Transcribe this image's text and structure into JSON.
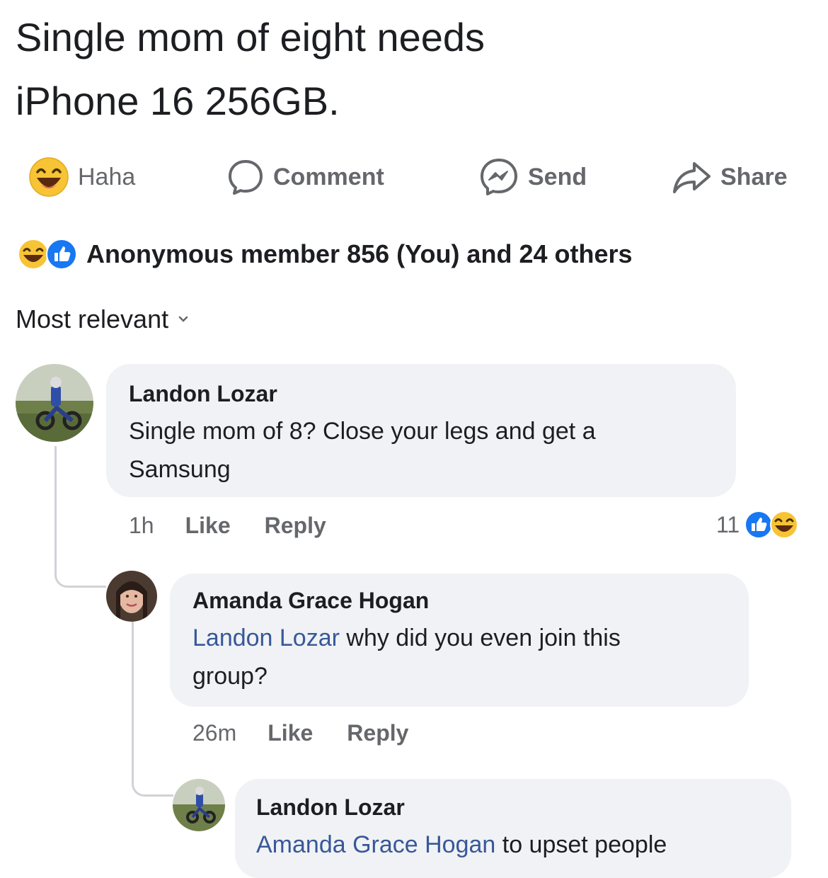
{
  "post": {
    "lines": [
      "Single mom of eight needs",
      "iPhone 16 256GB."
    ]
  },
  "actions": {
    "haha": "Haha",
    "comment": "Comment",
    "send": "Send",
    "share": "Share"
  },
  "reactions_summary": "Anonymous member 856 (You) and 24 others",
  "sort_label": "Most relevant",
  "comments": [
    {
      "author": "Landon Lozar",
      "text": [
        "Single mom of 8? Close your legs and get a",
        "Samsung"
      ],
      "time": "1h",
      "like": "Like",
      "reply": "Reply",
      "reaction_count": "11"
    },
    {
      "author": "Amanda Grace Hogan",
      "mention": "Landon Lozar",
      "text_after_mention": " why did you even join this",
      "text_line2": "group?",
      "time": "26m",
      "like": "Like",
      "reply": "Reply"
    },
    {
      "author": "Landon Lozar",
      "mention": "Amanda Grace Hogan",
      "text_after_mention": " to upset people"
    }
  ],
  "colors": {
    "text": "#1c1e21",
    "secondary": "#65676b",
    "bubble": "#f0f2f5",
    "mention": "#385898",
    "like_blue": "#1877f2",
    "haha_yellow": "#f7b928"
  }
}
